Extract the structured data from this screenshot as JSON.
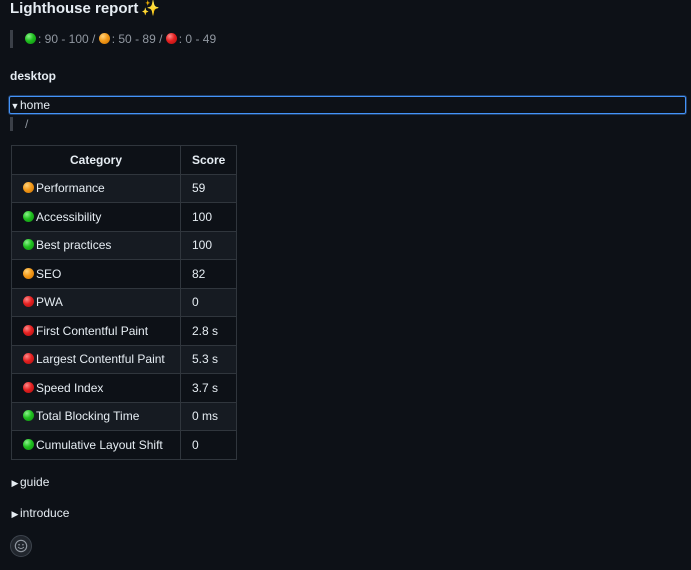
{
  "title": "Lighthouse report",
  "legend": {
    "good": ": 90 - 100 /",
    "average": ": 50 - 89 /",
    "poor": ": 0 - 49"
  },
  "section": "desktop",
  "details_open": {
    "label": "home",
    "path": "/"
  },
  "table": {
    "headers": [
      "Category",
      "Score"
    ],
    "rows": [
      {
        "status": "orange",
        "category": "Performance",
        "score": "59"
      },
      {
        "status": "green",
        "category": "Accessibility",
        "score": "100"
      },
      {
        "status": "green",
        "category": "Best practices",
        "score": "100"
      },
      {
        "status": "orange",
        "category": "SEO",
        "score": "82"
      },
      {
        "status": "red",
        "category": "PWA",
        "score": "0"
      },
      {
        "status": "red",
        "category": "First Contentful Paint",
        "score": "2.8 s"
      },
      {
        "status": "red",
        "category": "Largest Contentful Paint",
        "score": "5.3 s"
      },
      {
        "status": "red",
        "category": "Speed Index",
        "score": "3.7 s"
      },
      {
        "status": "green",
        "category": "Total Blocking Time",
        "score": "0 ms"
      },
      {
        "status": "green",
        "category": "Cumulative Layout Shift",
        "score": "0"
      }
    ]
  },
  "collapsed_sections": [
    "guide",
    "introduce"
  ],
  "colors": {
    "good": "#1fbf1f",
    "average": "#f39a1a",
    "poor": "#e52121",
    "focus": "#4493f8"
  }
}
